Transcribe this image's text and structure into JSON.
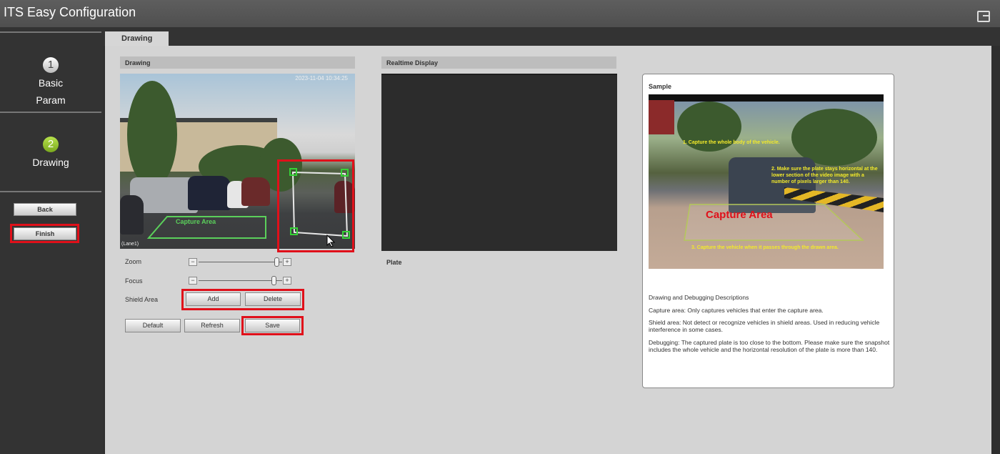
{
  "app": {
    "title": "ITS Easy Configuration",
    "logout_icon": "logout-icon"
  },
  "sidebar": {
    "steps": [
      {
        "number": "1",
        "line1": "Basic",
        "line2": "Param"
      },
      {
        "number": "2",
        "line1": "Drawing"
      }
    ],
    "back_label": "Back",
    "finish_label": "Finish"
  },
  "tabs": [
    {
      "label": "Drawing",
      "active": true
    }
  ],
  "drawing": {
    "section_title": "Drawing",
    "video": {
      "timestamp": "2023-11-04 10:34:25",
      "channel": "(Lane1)",
      "capture_area_label": "Capture Area"
    },
    "zoom": {
      "label": "Zoom",
      "minus": "−",
      "plus": "+",
      "value": 0.96
    },
    "focus": {
      "label": "Focus",
      "minus": "−",
      "plus": "+",
      "value": 0.93
    },
    "shield_area": {
      "label": "Shield Area",
      "add": "Add",
      "delete": "Delete"
    },
    "buttons": {
      "default": "Default",
      "refresh": "Refresh",
      "save": "Save"
    }
  },
  "realtime": {
    "section_title": "Realtime Display",
    "plate_label": "Plate"
  },
  "sample": {
    "title": "Sample",
    "image_notes": {
      "n1": "1. Capture the whole body of the vehicle.",
      "n2": "2. Make sure the plate stays horizontal at the lower section of the video image with a number of pixels larger than 140.",
      "n3": "3. Capture the vehicle when it passes through the drawn area.",
      "capture_area": "Capture Area"
    },
    "desc_title": "Drawing and Debugging Descriptions",
    "desc_capture": "Capture area: Only captures vehicles that enter the capture area.",
    "desc_shield": "Shield area: Not detect or recognize vehicles in shield areas. Used in reducing vehicle interference in some cases.",
    "desc_debug": "Debugging: The captured plate is too close to the bottom. Please make sure the snapshot includes the whole vehicle and the horizontal resolution of the plate is more than 140."
  }
}
